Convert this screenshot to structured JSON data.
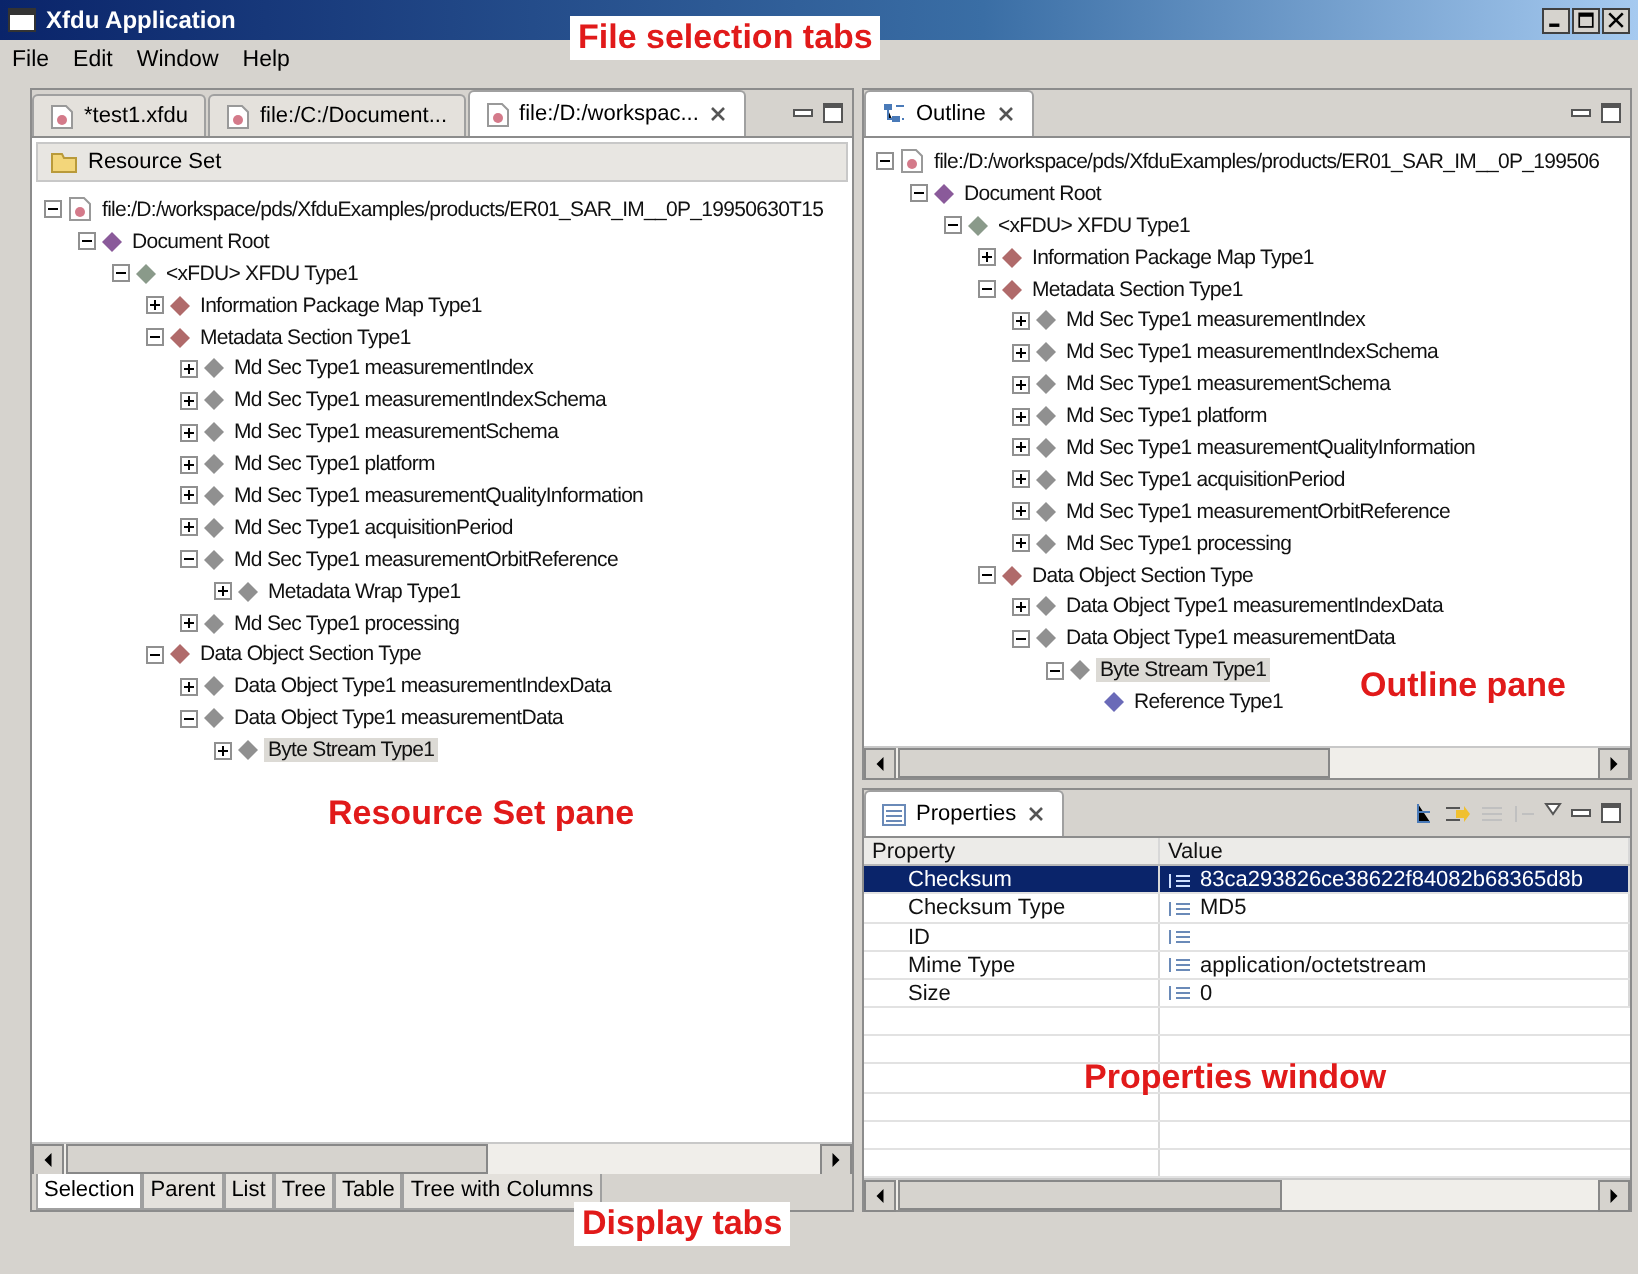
{
  "window": {
    "title": "Xfdu Application"
  },
  "menu": [
    "File",
    "Edit",
    "Window",
    "Help"
  ],
  "editor_tabs": [
    {
      "label": "*test1.xfdu",
      "selected": false
    },
    {
      "label": "file:/C:/Document...",
      "selected": false
    },
    {
      "label": "file:/D:/workspac...",
      "selected": true
    }
  ],
  "resource_set": {
    "title": "Resource Set",
    "tree": [
      {
        "label": "file:/D:/workspace/pds/XfduExamples/products/ER01_SAR_IM__0P_19950630T15",
        "kind": "file",
        "expanded": true,
        "selected": false,
        "children": [
          {
            "label": "Document Root",
            "kind": "element",
            "expanded": true,
            "selected": false,
            "children": [
              {
                "label": "<xFDU> XFDU Type1",
                "kind": "element",
                "expanded": true,
                "selected": false,
                "children": [
                  {
                    "label": "Information Package Map Type1",
                    "kind": "element",
                    "expanded": false,
                    "selected": false
                  },
                  {
                    "label": "Metadata Section Type1",
                    "kind": "element",
                    "expanded": true,
                    "selected": false,
                    "children": [
                      {
                        "label": "Md Sec Type1 measurementIndex",
                        "kind": "element",
                        "expanded": false,
                        "selected": false
                      },
                      {
                        "label": "Md Sec Type1 measurementIndexSchema",
                        "kind": "element",
                        "expanded": false,
                        "selected": false
                      },
                      {
                        "label": "Md Sec Type1 measurementSchema",
                        "kind": "element",
                        "expanded": false,
                        "selected": false
                      },
                      {
                        "label": "Md Sec Type1 platform",
                        "kind": "element",
                        "expanded": false,
                        "selected": false
                      },
                      {
                        "label": "Md Sec Type1 measurementQualityInformation",
                        "kind": "element",
                        "expanded": false,
                        "selected": false
                      },
                      {
                        "label": "Md Sec Type1 acquisitionPeriod",
                        "kind": "element",
                        "expanded": false,
                        "selected": false
                      },
                      {
                        "label": "Md Sec Type1 measurementOrbitReference",
                        "kind": "element",
                        "expanded": true,
                        "selected": false,
                        "children": [
                          {
                            "label": "Metadata Wrap Type1",
                            "kind": "element",
                            "expanded": false,
                            "selected": false
                          }
                        ]
                      },
                      {
                        "label": "Md Sec Type1 processing",
                        "kind": "element",
                        "expanded": false,
                        "selected": false
                      }
                    ]
                  },
                  {
                    "label": "Data Object Section Type",
                    "kind": "element",
                    "expanded": true,
                    "selected": false,
                    "children": [
                      {
                        "label": "Data Object Type1 measurementIndexData",
                        "kind": "element",
                        "expanded": false,
                        "selected": false
                      },
                      {
                        "label": "Data Object Type1 measurementData",
                        "kind": "element",
                        "expanded": true,
                        "selected": false,
                        "children": [
                          {
                            "label": "Byte Stream Type1",
                            "kind": "element",
                            "expanded": false,
                            "selected": true
                          }
                        ]
                      }
                    ]
                  }
                ]
              }
            ]
          }
        ]
      }
    ]
  },
  "display_tabs": [
    {
      "label": "Selection",
      "selected": true
    },
    {
      "label": "Parent",
      "selected": false
    },
    {
      "label": "List",
      "selected": false
    },
    {
      "label": "Tree",
      "selected": false
    },
    {
      "label": "Table",
      "selected": false
    },
    {
      "label": "Tree with Columns",
      "selected": false
    }
  ],
  "outline": {
    "title": "Outline",
    "tree": [
      {
        "label": "file:/D:/workspace/pds/XfduExamples/products/ER01_SAR_IM__0P_199506",
        "kind": "file",
        "expanded": true,
        "selected": false,
        "children": [
          {
            "label": "Document Root",
            "kind": "element",
            "expanded": true,
            "selected": false,
            "children": [
              {
                "label": "<xFDU> XFDU Type1",
                "kind": "element",
                "expanded": true,
                "selected": false,
                "children": [
                  {
                    "label": "Information Package Map Type1",
                    "kind": "element",
                    "expanded": false,
                    "selected": false
                  },
                  {
                    "label": "Metadata Section Type1",
                    "kind": "element",
                    "expanded": true,
                    "selected": false,
                    "children": [
                      {
                        "label": "Md Sec Type1 measurementIndex",
                        "kind": "element",
                        "expanded": false,
                        "selected": false
                      },
                      {
                        "label": "Md Sec Type1 measurementIndexSchema",
                        "kind": "element",
                        "expanded": false,
                        "selected": false
                      },
                      {
                        "label": "Md Sec Type1 measurementSchema",
                        "kind": "element",
                        "expanded": false,
                        "selected": false
                      },
                      {
                        "label": "Md Sec Type1 platform",
                        "kind": "element",
                        "expanded": false,
                        "selected": false
                      },
                      {
                        "label": "Md Sec Type1 measurementQualityInformation",
                        "kind": "element",
                        "expanded": false,
                        "selected": false
                      },
                      {
                        "label": "Md Sec Type1 acquisitionPeriod",
                        "kind": "element",
                        "expanded": false,
                        "selected": false
                      },
                      {
                        "label": "Md Sec Type1 measurementOrbitReference",
                        "kind": "element",
                        "expanded": false,
                        "selected": false
                      },
                      {
                        "label": "Md Sec Type1 processing",
                        "kind": "element",
                        "expanded": false,
                        "selected": false
                      }
                    ]
                  },
                  {
                    "label": "Data Object Section Type",
                    "kind": "element",
                    "expanded": true,
                    "selected": false,
                    "children": [
                      {
                        "label": "Data Object Type1 measurementIndexData",
                        "kind": "element",
                        "expanded": false,
                        "selected": false
                      },
                      {
                        "label": "Data Object Type1 measurementData",
                        "kind": "element",
                        "expanded": true,
                        "selected": false,
                        "children": [
                          {
                            "label": "Byte Stream Type1",
                            "kind": "element",
                            "expanded": true,
                            "selected": true,
                            "children": [
                              {
                                "label": "Reference Type1",
                                "kind": "leaf",
                                "selected": false
                              }
                            ]
                          }
                        ]
                      }
                    ]
                  }
                ]
              }
            ]
          }
        ]
      }
    ]
  },
  "properties": {
    "title": "Properties",
    "columns": [
      "Property",
      "Value"
    ],
    "rows": [
      {
        "property": "Checksum",
        "value": "83ca293826ce38622f84082b68365d8b",
        "selected": true
      },
      {
        "property": "Checksum Type",
        "value": "MD5",
        "selected": false
      },
      {
        "property": "ID",
        "selected": false
      },
      {
        "property": "Mime Type",
        "value": "application/octetstream",
        "selected": false
      },
      {
        "property": "Size",
        "value": "0",
        "selected": false
      }
    ]
  },
  "annotations": [
    "File selection tabs",
    "Resource Set pane",
    "Outline pane",
    "Properties window",
    "Display tabs"
  ]
}
